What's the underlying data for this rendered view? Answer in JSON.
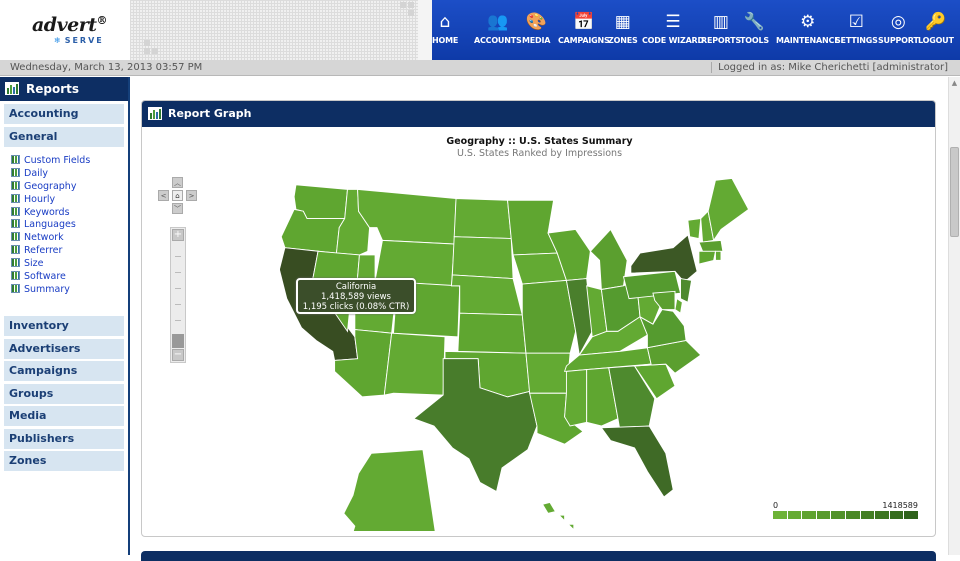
{
  "logo": {
    "brand": "advert",
    "registered": "®",
    "sub": "SERVE"
  },
  "nav": [
    {
      "label": "HOME",
      "icon": "home-icon",
      "glyph": "⌂"
    },
    {
      "label": "ACCOUNTS",
      "icon": "accounts-icon",
      "glyph": "👥"
    },
    {
      "label": "MEDIA",
      "icon": "media-icon",
      "glyph": "🎨"
    },
    {
      "label": "CAMPAIGNS",
      "icon": "campaigns-icon",
      "glyph": "📅"
    },
    {
      "label": "ZONES",
      "icon": "zones-icon",
      "glyph": "▦"
    },
    {
      "label": "CODE WIZARD",
      "icon": "code-wizard-icon",
      "glyph": "☰"
    },
    {
      "label": "REPORTS",
      "icon": "reports-icon",
      "glyph": "▥"
    },
    {
      "label": "TOOLS",
      "icon": "tools-icon",
      "glyph": "🔧"
    },
    {
      "label": "MAINTENANCE",
      "icon": "maintenance-icon",
      "glyph": "⚙"
    },
    {
      "label": "SETTINGS",
      "icon": "settings-icon",
      "glyph": "☑"
    },
    {
      "label": "SUPPORT",
      "icon": "support-icon",
      "glyph": "◎"
    },
    {
      "label": "LOGOUT",
      "icon": "logout-icon",
      "glyph": "🔑"
    }
  ],
  "status": {
    "date": "Wednesday, March 13, 2013 03:57 PM",
    "login": "Logged in as: Mike Cherichetti [administrator]"
  },
  "sidebar": {
    "title": "Reports",
    "sections_top": [
      "Accounting",
      "General"
    ],
    "general_links": [
      "Custom Fields",
      "Daily",
      "Geography",
      "Hourly",
      "Keywords",
      "Languages",
      "Network",
      "Referrer",
      "Size",
      "Software",
      "Summary"
    ],
    "sections_bottom": [
      "Inventory",
      "Advertisers",
      "Campaigns",
      "Groups",
      "Media",
      "Publishers",
      "Zones"
    ]
  },
  "panel": {
    "title": "Report Graph",
    "chart_title": "Geography :: U.S. States Summary",
    "chart_subtitle": "U.S. States Ranked by Impressions"
  },
  "tooltip": {
    "state": "California",
    "views": "1,418,589 views",
    "clicks": "1,195 clicks (0.08% CTR)"
  },
  "chart_data": {
    "type": "choropleth",
    "title": "Geography :: U.S. States Summary",
    "subtitle": "U.S. States Ranked by Impressions",
    "legend_min": "0",
    "legend_max": "1418589",
    "legend_colors": [
      "#6db336",
      "#66ab33",
      "#5fa32f",
      "#589a2c",
      "#519229",
      "#4a8926",
      "#437f23",
      "#3c7620",
      "#356c1d",
      "#2e621a"
    ],
    "states": [
      {
        "abbr": "WA",
        "color": "#5fa630"
      },
      {
        "abbr": "OR",
        "color": "#5fa630"
      },
      {
        "abbr": "CA",
        "color": "#384d22"
      },
      {
        "abbr": "ID",
        "color": "#64ab33"
      },
      {
        "abbr": "NV",
        "color": "#5fa630"
      },
      {
        "abbr": "MT",
        "color": "#63aa33"
      },
      {
        "abbr": "WY",
        "color": "#63aa33"
      },
      {
        "abbr": "UT",
        "color": "#63aa33"
      },
      {
        "abbr": "AZ",
        "color": "#5fa630"
      },
      {
        "abbr": "CO",
        "color": "#5fa630"
      },
      {
        "abbr": "NM",
        "color": "#63aa33"
      },
      {
        "abbr": "ND",
        "color": "#63aa33"
      },
      {
        "abbr": "SD",
        "color": "#63aa33"
      },
      {
        "abbr": "NE",
        "color": "#63aa33"
      },
      {
        "abbr": "KS",
        "color": "#5fa630"
      },
      {
        "abbr": "OK",
        "color": "#5fa630"
      },
      {
        "abbr": "TX",
        "color": "#487c2b"
      },
      {
        "abbr": "MN",
        "color": "#5fa630"
      },
      {
        "abbr": "IA",
        "color": "#63aa33"
      },
      {
        "abbr": "MO",
        "color": "#5b9f2f"
      },
      {
        "abbr": "AR",
        "color": "#63aa33"
      },
      {
        "abbr": "LA",
        "color": "#5fa630"
      },
      {
        "abbr": "WI",
        "color": "#5fa630"
      },
      {
        "abbr": "IL",
        "color": "#4a7f2c"
      },
      {
        "abbr": "MI",
        "color": "#5b9f2f"
      },
      {
        "abbr": "IN",
        "color": "#63aa33"
      },
      {
        "abbr": "OH",
        "color": "#559b2f"
      },
      {
        "abbr": "KY",
        "color": "#63aa33"
      },
      {
        "abbr": "TN",
        "color": "#5fa630"
      },
      {
        "abbr": "MS",
        "color": "#63aa33"
      },
      {
        "abbr": "AL",
        "color": "#5fa630"
      },
      {
        "abbr": "GA",
        "color": "#4e8a2e"
      },
      {
        "abbr": "FL",
        "color": "#3f6a26"
      },
      {
        "abbr": "SC",
        "color": "#5fa630"
      },
      {
        "abbr": "NC",
        "color": "#5b9f2f"
      },
      {
        "abbr": "VA",
        "color": "#559b2f"
      },
      {
        "abbr": "WV",
        "color": "#63aa33"
      },
      {
        "abbr": "PA",
        "color": "#559b2f"
      },
      {
        "abbr": "NY",
        "color": "#3c5825"
      },
      {
        "abbr": "VT",
        "color": "#63aa33"
      },
      {
        "abbr": "NH",
        "color": "#63aa33"
      },
      {
        "abbr": "ME",
        "color": "#63aa33"
      },
      {
        "abbr": "MA",
        "color": "#5b9f2f"
      },
      {
        "abbr": "CT",
        "color": "#5fa630"
      },
      {
        "abbr": "NJ",
        "color": "#4e8a2e"
      },
      {
        "abbr": "MD",
        "color": "#5b9f2f"
      },
      {
        "abbr": "DE",
        "color": "#63aa33"
      },
      {
        "abbr": "RI",
        "color": "#63aa33"
      },
      {
        "abbr": "AK",
        "color": "#63aa33"
      },
      {
        "abbr": "HI",
        "color": "#63aa33"
      }
    ]
  }
}
